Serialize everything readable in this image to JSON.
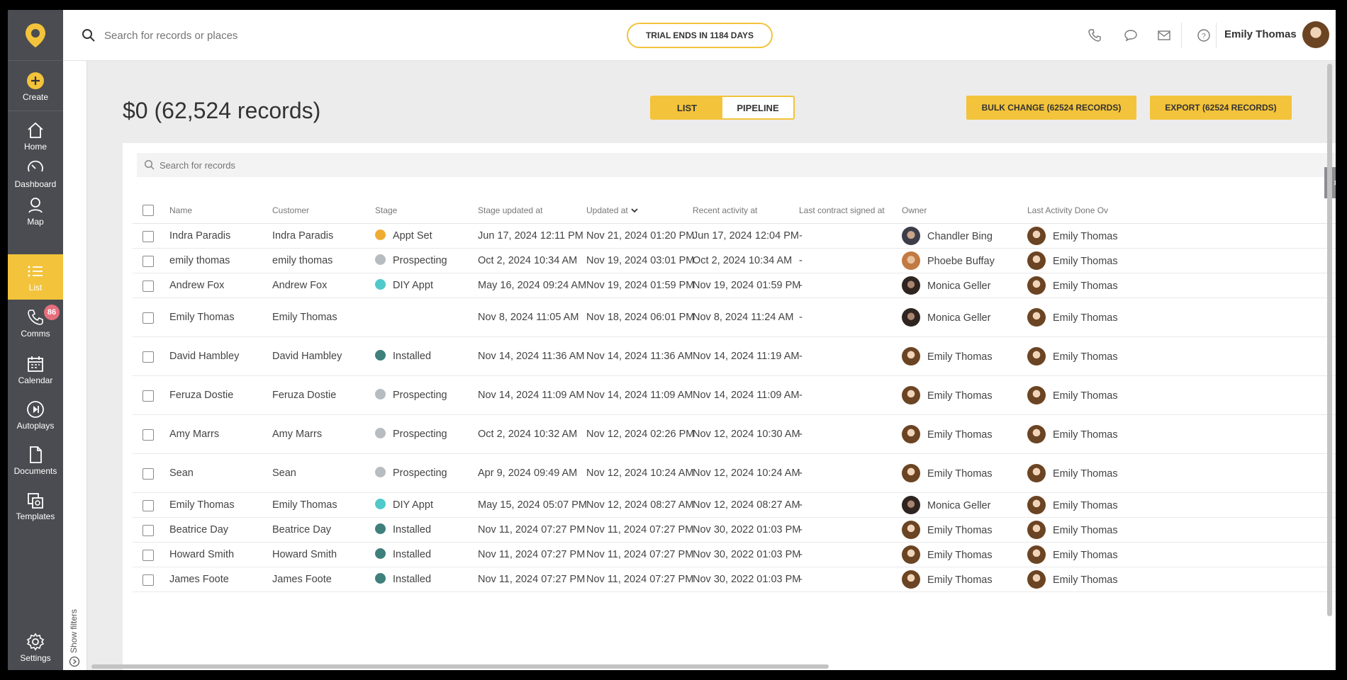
{
  "topbar": {
    "search_placeholder": "Search for records or places",
    "trial_text": "TRIAL ENDS IN 1184 DAYS",
    "user_name": "Emily Thomas"
  },
  "sidebar": {
    "create": "Create",
    "items": [
      {
        "label": "Home",
        "icon": "home-icon"
      },
      {
        "label": "Dashboard",
        "icon": "dashboard-icon"
      },
      {
        "label": "Map",
        "icon": "map-pin-icon"
      },
      {
        "label": "List",
        "icon": "list-icon"
      },
      {
        "label": "Comms",
        "icon": "phone-icon"
      },
      {
        "label": "Calendar",
        "icon": "calendar-icon"
      },
      {
        "label": "Autoplays",
        "icon": "play-forward-icon"
      },
      {
        "label": "Documents",
        "icon": "document-icon"
      },
      {
        "label": "Templates",
        "icon": "templates-icon"
      },
      {
        "label": "Settings",
        "icon": "gear-icon"
      }
    ],
    "comms_badge": "86",
    "active": "List",
    "accent_color": "#f3c33b"
  },
  "filters": {
    "label": "Show filters"
  },
  "page": {
    "title": "$0 (62,524 records)",
    "view_list": "LIST",
    "view_pipeline": "PIPELINE",
    "bulk_change": "BULK CHANGE (62524 RECORDS)",
    "export": "EXPORT (62524 RECORDS)"
  },
  "records_search_placeholder": "Search for records",
  "table": {
    "columns": [
      "Name",
      "Customer",
      "Stage",
      "Stage updated at",
      "Updated at",
      "Recent activity at",
      "Last contract signed at",
      "Owner",
      "Last Activity Done Ov"
    ],
    "stage_colors": {
      "Appt Set": "#f0ac32",
      "Prospecting": "#b7bcc1",
      "DIY Appt": "#4fc9c9",
      "Installed": "#3f7f7c"
    },
    "rows": [
      {
        "name": "Indra Paradis",
        "customer": "Indra Paradis",
        "stage": "Appt Set",
        "stage_updated": "Jun 17, 2024 12:11 PM",
        "updated": "Nov 21, 2024 01:20 PM",
        "recent": "Jun 17, 2024 12:04 PM",
        "contract": "-",
        "owner": "Chandler Bing",
        "owner_avatar": "chandler",
        "last_by": "Emily Thomas"
      },
      {
        "name": "emily thomas",
        "customer": "emily thomas",
        "stage": "Prospecting",
        "stage_updated": "Oct 2, 2024 10:34 AM",
        "updated": "Nov 19, 2024 03:01 PM",
        "recent": "Oct 2, 2024 10:34 AM",
        "contract": "-",
        "owner": "Phoebe Buffay",
        "owner_avatar": "phoebe",
        "last_by": "Emily Thomas"
      },
      {
        "name": "Andrew Fox",
        "customer": "Andrew Fox",
        "stage": "DIY Appt",
        "stage_updated": "May 16, 2024 09:24 AM",
        "updated": "Nov 19, 2024 01:59 PM",
        "recent": "Nov 19, 2024 01:59 PM",
        "contract": "-",
        "owner": "Monica Geller",
        "owner_avatar": "monica",
        "last_by": "Emily Thomas"
      },
      {
        "name": "Emily Thomas",
        "customer": "Emily Thomas",
        "stage": "",
        "stage_updated": "Nov 8, 2024 11:05 AM",
        "updated": "Nov 18, 2024 06:01 PM",
        "recent": "Nov 8, 2024 11:24 AM",
        "contract": "-",
        "owner": "Monica Geller",
        "owner_avatar": "monica",
        "last_by": "Emily Thomas"
      },
      {
        "name": "David Hambley",
        "customer": "David Hambley",
        "stage": "Installed",
        "stage_updated": "Nov 14, 2024 11:36 AM",
        "updated": "Nov 14, 2024 11:36 AM",
        "recent": "Nov 14, 2024 11:19 AM",
        "contract": "-",
        "owner": "Emily Thomas",
        "owner_avatar": "emily",
        "last_by": "Emily Thomas"
      },
      {
        "name": "Feruza Dostie",
        "customer": "Feruza Dostie",
        "stage": "Prospecting",
        "stage_updated": "Nov 14, 2024 11:09 AM",
        "updated": "Nov 14, 2024 11:09 AM",
        "recent": "Nov 14, 2024 11:09 AM",
        "contract": "-",
        "owner": "Emily Thomas",
        "owner_avatar": "emily",
        "last_by": "Emily Thomas"
      },
      {
        "name": "Amy Marrs",
        "customer": "Amy Marrs",
        "stage": "Prospecting",
        "stage_updated": "Oct 2, 2024 10:32 AM",
        "updated": "Nov 12, 2024 02:26 PM",
        "recent": "Nov 12, 2024 10:30 AM",
        "contract": "-",
        "owner": "Emily Thomas",
        "owner_avatar": "emily",
        "last_by": "Emily Thomas"
      },
      {
        "name": "Sean",
        "customer": "Sean",
        "stage": "Prospecting",
        "stage_updated": "Apr 9, 2024 09:49 AM",
        "updated": "Nov 12, 2024 10:24 AM",
        "recent": "Nov 12, 2024 10:24 AM",
        "contract": "-",
        "owner": "Emily Thomas",
        "owner_avatar": "emily",
        "last_by": "Emily Thomas"
      },
      {
        "name": "Emily Thomas",
        "customer": "Emily Thomas",
        "stage": "DIY Appt",
        "stage_updated": "May 15, 2024 05:07 PM",
        "updated": "Nov 12, 2024 08:27 AM",
        "recent": "Nov 12, 2024 08:27 AM",
        "contract": "-",
        "owner": "Monica Geller",
        "owner_avatar": "monica",
        "last_by": "Emily Thomas"
      },
      {
        "name": "Beatrice Day",
        "customer": "Beatrice Day",
        "stage": "Installed",
        "stage_updated": "Nov 11, 2024 07:27 PM",
        "updated": "Nov 11, 2024 07:27 PM",
        "recent": "Nov 30, 2022 01:03 PM",
        "contract": "-",
        "owner": "Emily Thomas",
        "owner_avatar": "emily",
        "last_by": "Emily Thomas"
      },
      {
        "name": "Howard Smith",
        "customer": "Howard Smith",
        "stage": "Installed",
        "stage_updated": "Nov 11, 2024 07:27 PM",
        "updated": "Nov 11, 2024 07:27 PM",
        "recent": "Nov 30, 2022 01:03 PM",
        "contract": "-",
        "owner": "Emily Thomas",
        "owner_avatar": "emily",
        "last_by": "Emily Thomas"
      },
      {
        "name": "James Foote",
        "customer": "James Foote",
        "stage": "Installed",
        "stage_updated": "Nov 11, 2024 07:27 PM",
        "updated": "Nov 11, 2024 07:27 PM",
        "recent": "Nov 30, 2022 01:03 PM",
        "contract": "-",
        "owner": "Emily Thomas",
        "owner_avatar": "emily",
        "last_by": "Emily Thomas"
      }
    ]
  }
}
